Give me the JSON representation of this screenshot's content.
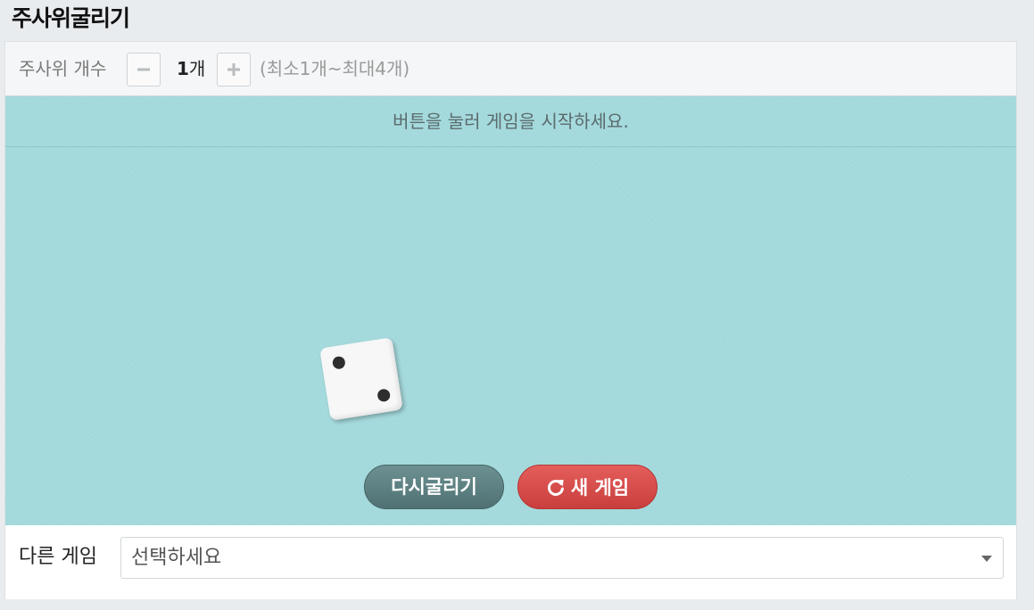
{
  "title": "주사위굴리기",
  "controls": {
    "label": "주사위 개수",
    "count": "1",
    "count_unit": "개",
    "range_note": "(최소1개~최대4개)"
  },
  "board": {
    "message": "버튼을 눌러 게임을 시작하세요.",
    "die_face": 2
  },
  "buttons": {
    "roll_label": "다시굴리기",
    "new_game_label": "새 게임",
    "new_game_icon": "refresh-icon"
  },
  "other_game": {
    "label": "다른 게임",
    "selected": "선택하세요"
  },
  "colors": {
    "board": "#a3d9dc",
    "roll_button": "#5e8283",
    "new_game_button": "#d84c4a"
  }
}
